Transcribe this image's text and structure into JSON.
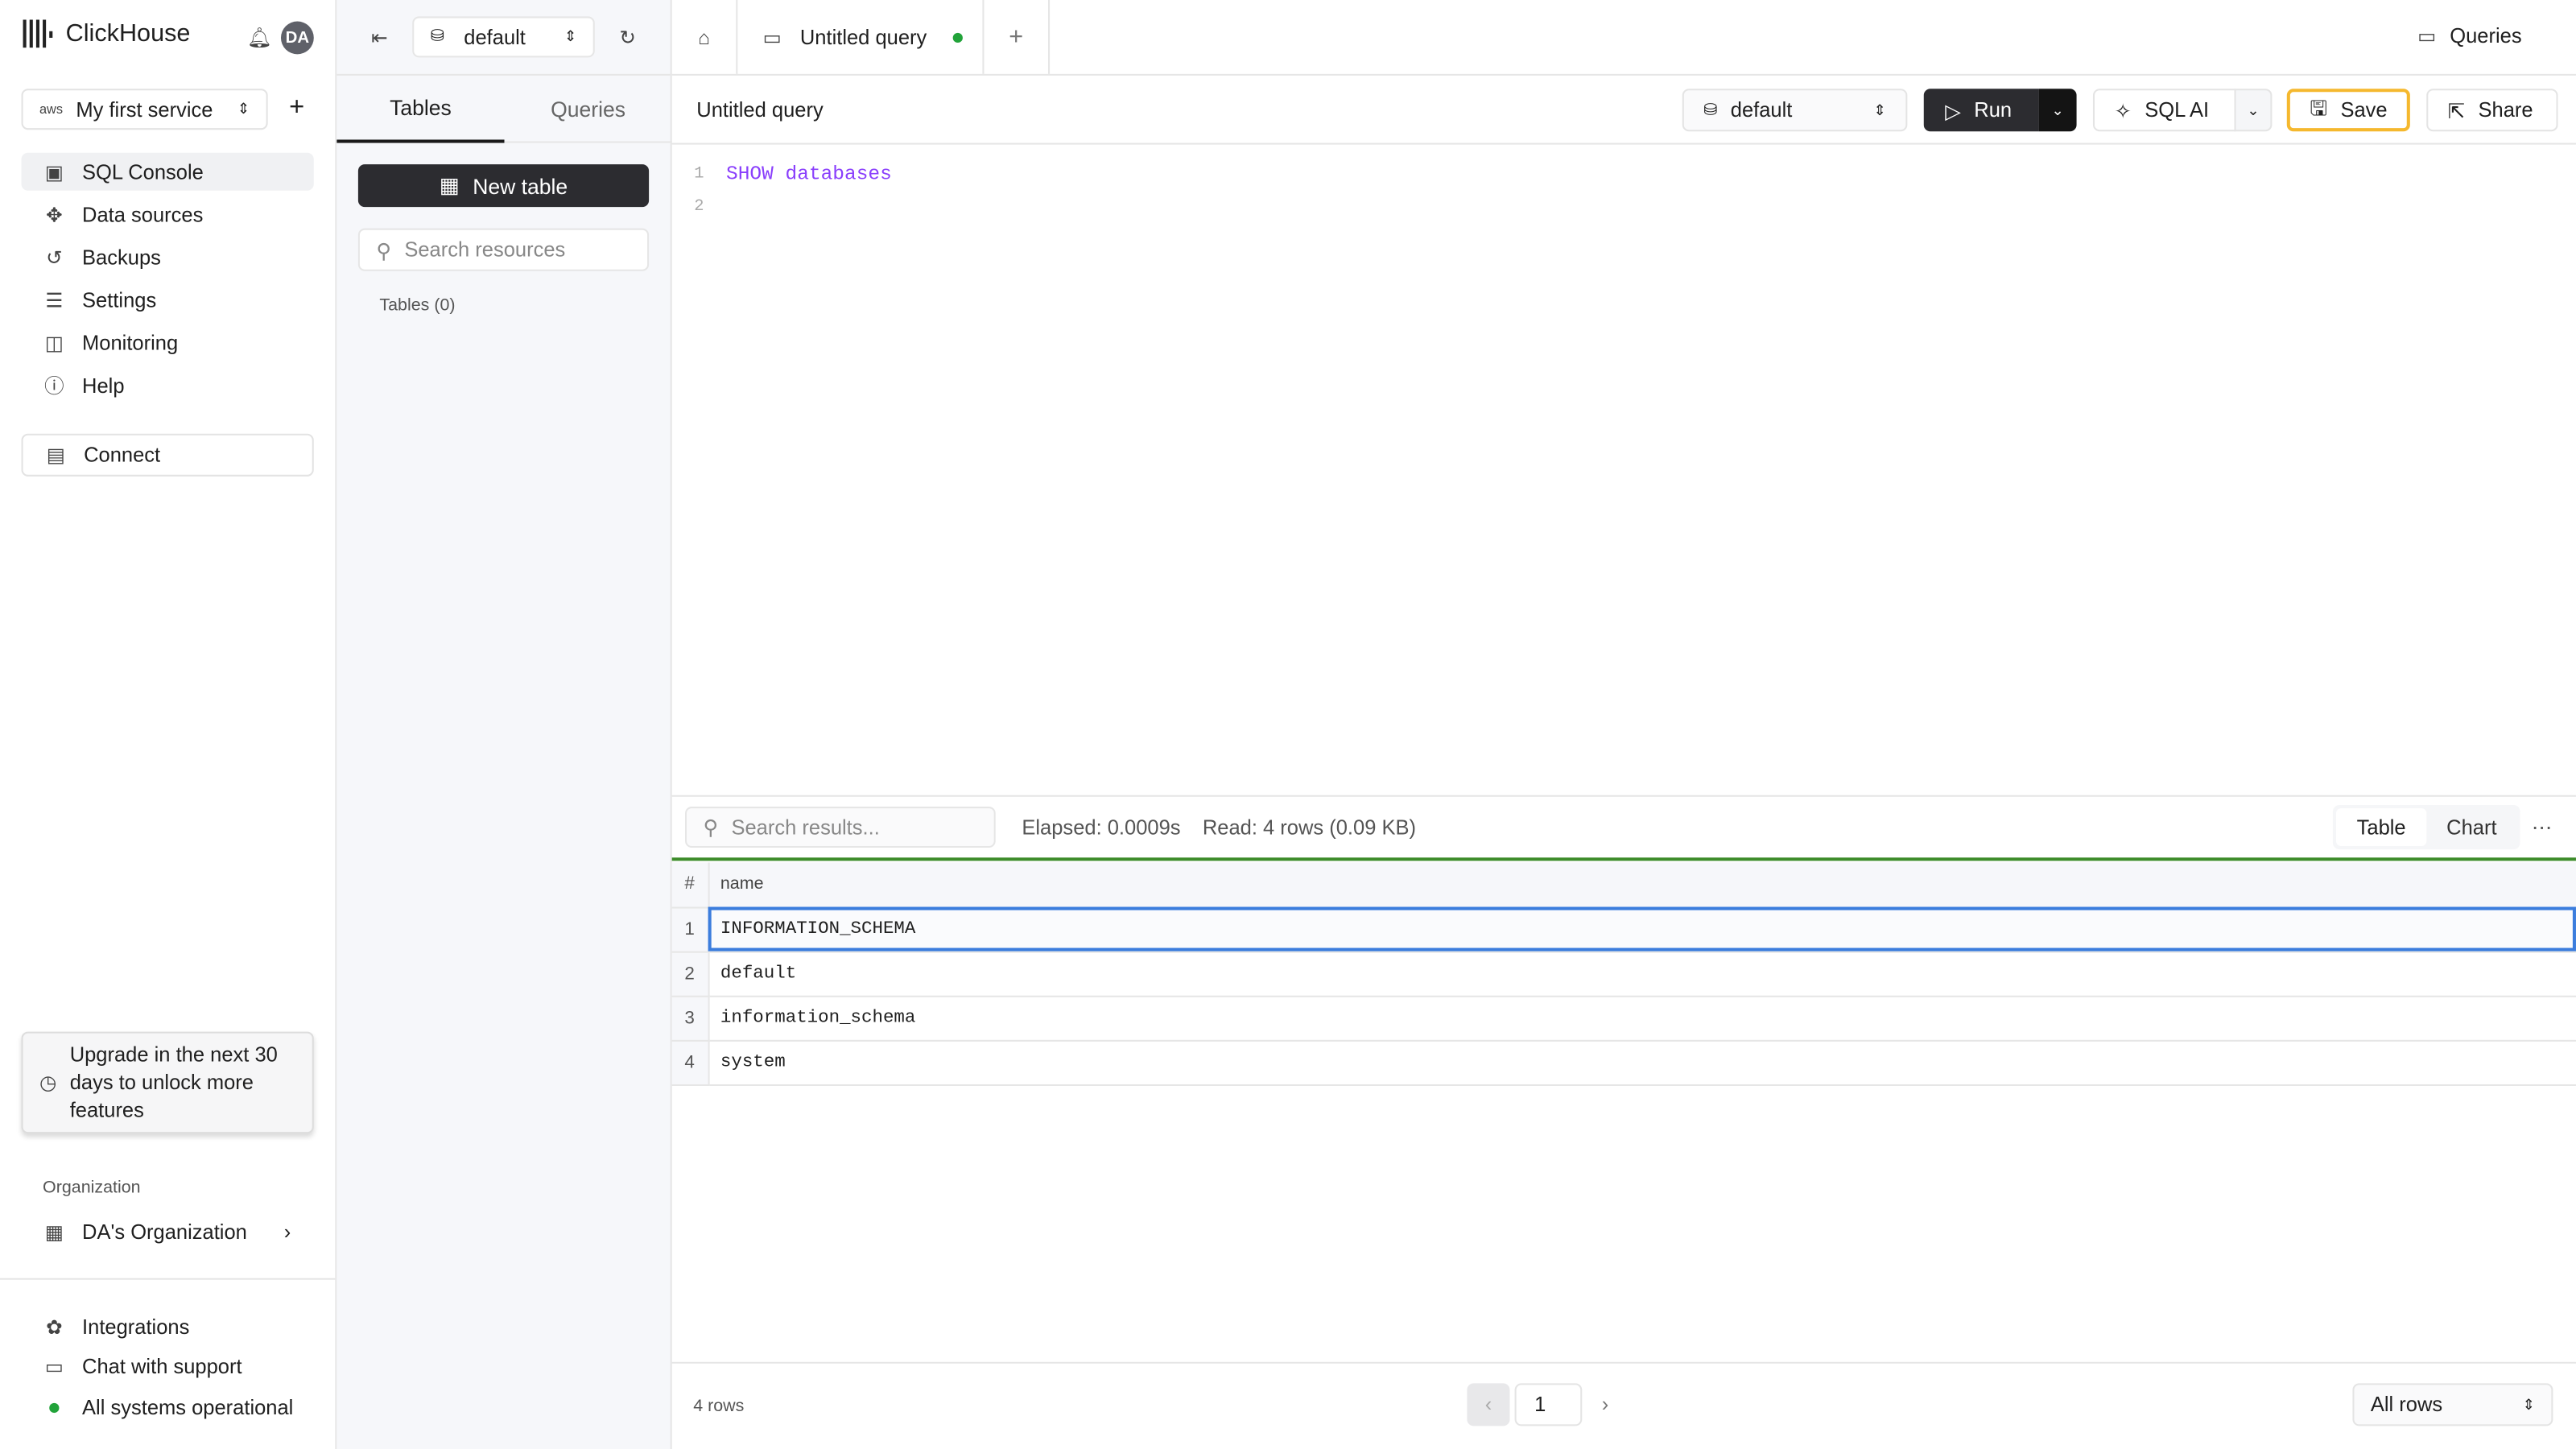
{
  "app": {
    "name": "ClickHouse",
    "avatar": "DA"
  },
  "sidebar": {
    "service": "My first service",
    "service_provider": "aws",
    "items": [
      {
        "label": "SQL Console",
        "icon": "monitor-icon"
      },
      {
        "label": "Data sources",
        "icon": "plug-icon"
      },
      {
        "label": "Backups",
        "icon": "backup-icon"
      },
      {
        "label": "Settings",
        "icon": "sliders-icon"
      },
      {
        "label": "Monitoring",
        "icon": "chart-icon"
      },
      {
        "label": "Help",
        "icon": "help-icon"
      }
    ],
    "connect": "Connect",
    "upgrade": "Upgrade in the next 30 days to unlock more features",
    "org_heading": "Organization",
    "org": "DA's Organization",
    "footer": [
      {
        "label": "Integrations"
      },
      {
        "label": "Chat with support"
      },
      {
        "label": "All systems operational"
      }
    ],
    "status_color": "#22a33a"
  },
  "panel": {
    "database": "default",
    "tabs": [
      "Tables",
      "Queries"
    ],
    "new_table": "New table",
    "search_placeholder": "Search resources",
    "tables_heading": "Tables (0)"
  },
  "main": {
    "tab_title": "Untitled query",
    "queries_link": "Queries",
    "query_title": "Untitled query",
    "db": "default",
    "buttons": {
      "run": "Run",
      "sql_ai": "SQL AI",
      "save": "Save",
      "share": "Share"
    },
    "code": [
      {
        "n": "1",
        "text": "SHOW databases"
      },
      {
        "n": "2",
        "text": ""
      }
    ],
    "results": {
      "search_placeholder": "Search results...",
      "elapsed": "Elapsed: 0.0009s",
      "read": "Read: 4 rows (0.09 KB)",
      "view_tabs": [
        "Table",
        "Chart"
      ],
      "columns": [
        "#",
        "name"
      ],
      "rows": [
        [
          "1",
          "INFORMATION_SCHEMA"
        ],
        [
          "2",
          "default"
        ],
        [
          "3",
          "information_schema"
        ],
        [
          "4",
          "system"
        ]
      ],
      "row_count": "4 rows",
      "page": "1",
      "rows_select": "All rows"
    },
    "accent": {
      "save_border": "#f5b82e",
      "success_bar": "#3d8c2a",
      "selected_cell": "#3b7ddd",
      "keyword": "#8a3ffc"
    }
  }
}
